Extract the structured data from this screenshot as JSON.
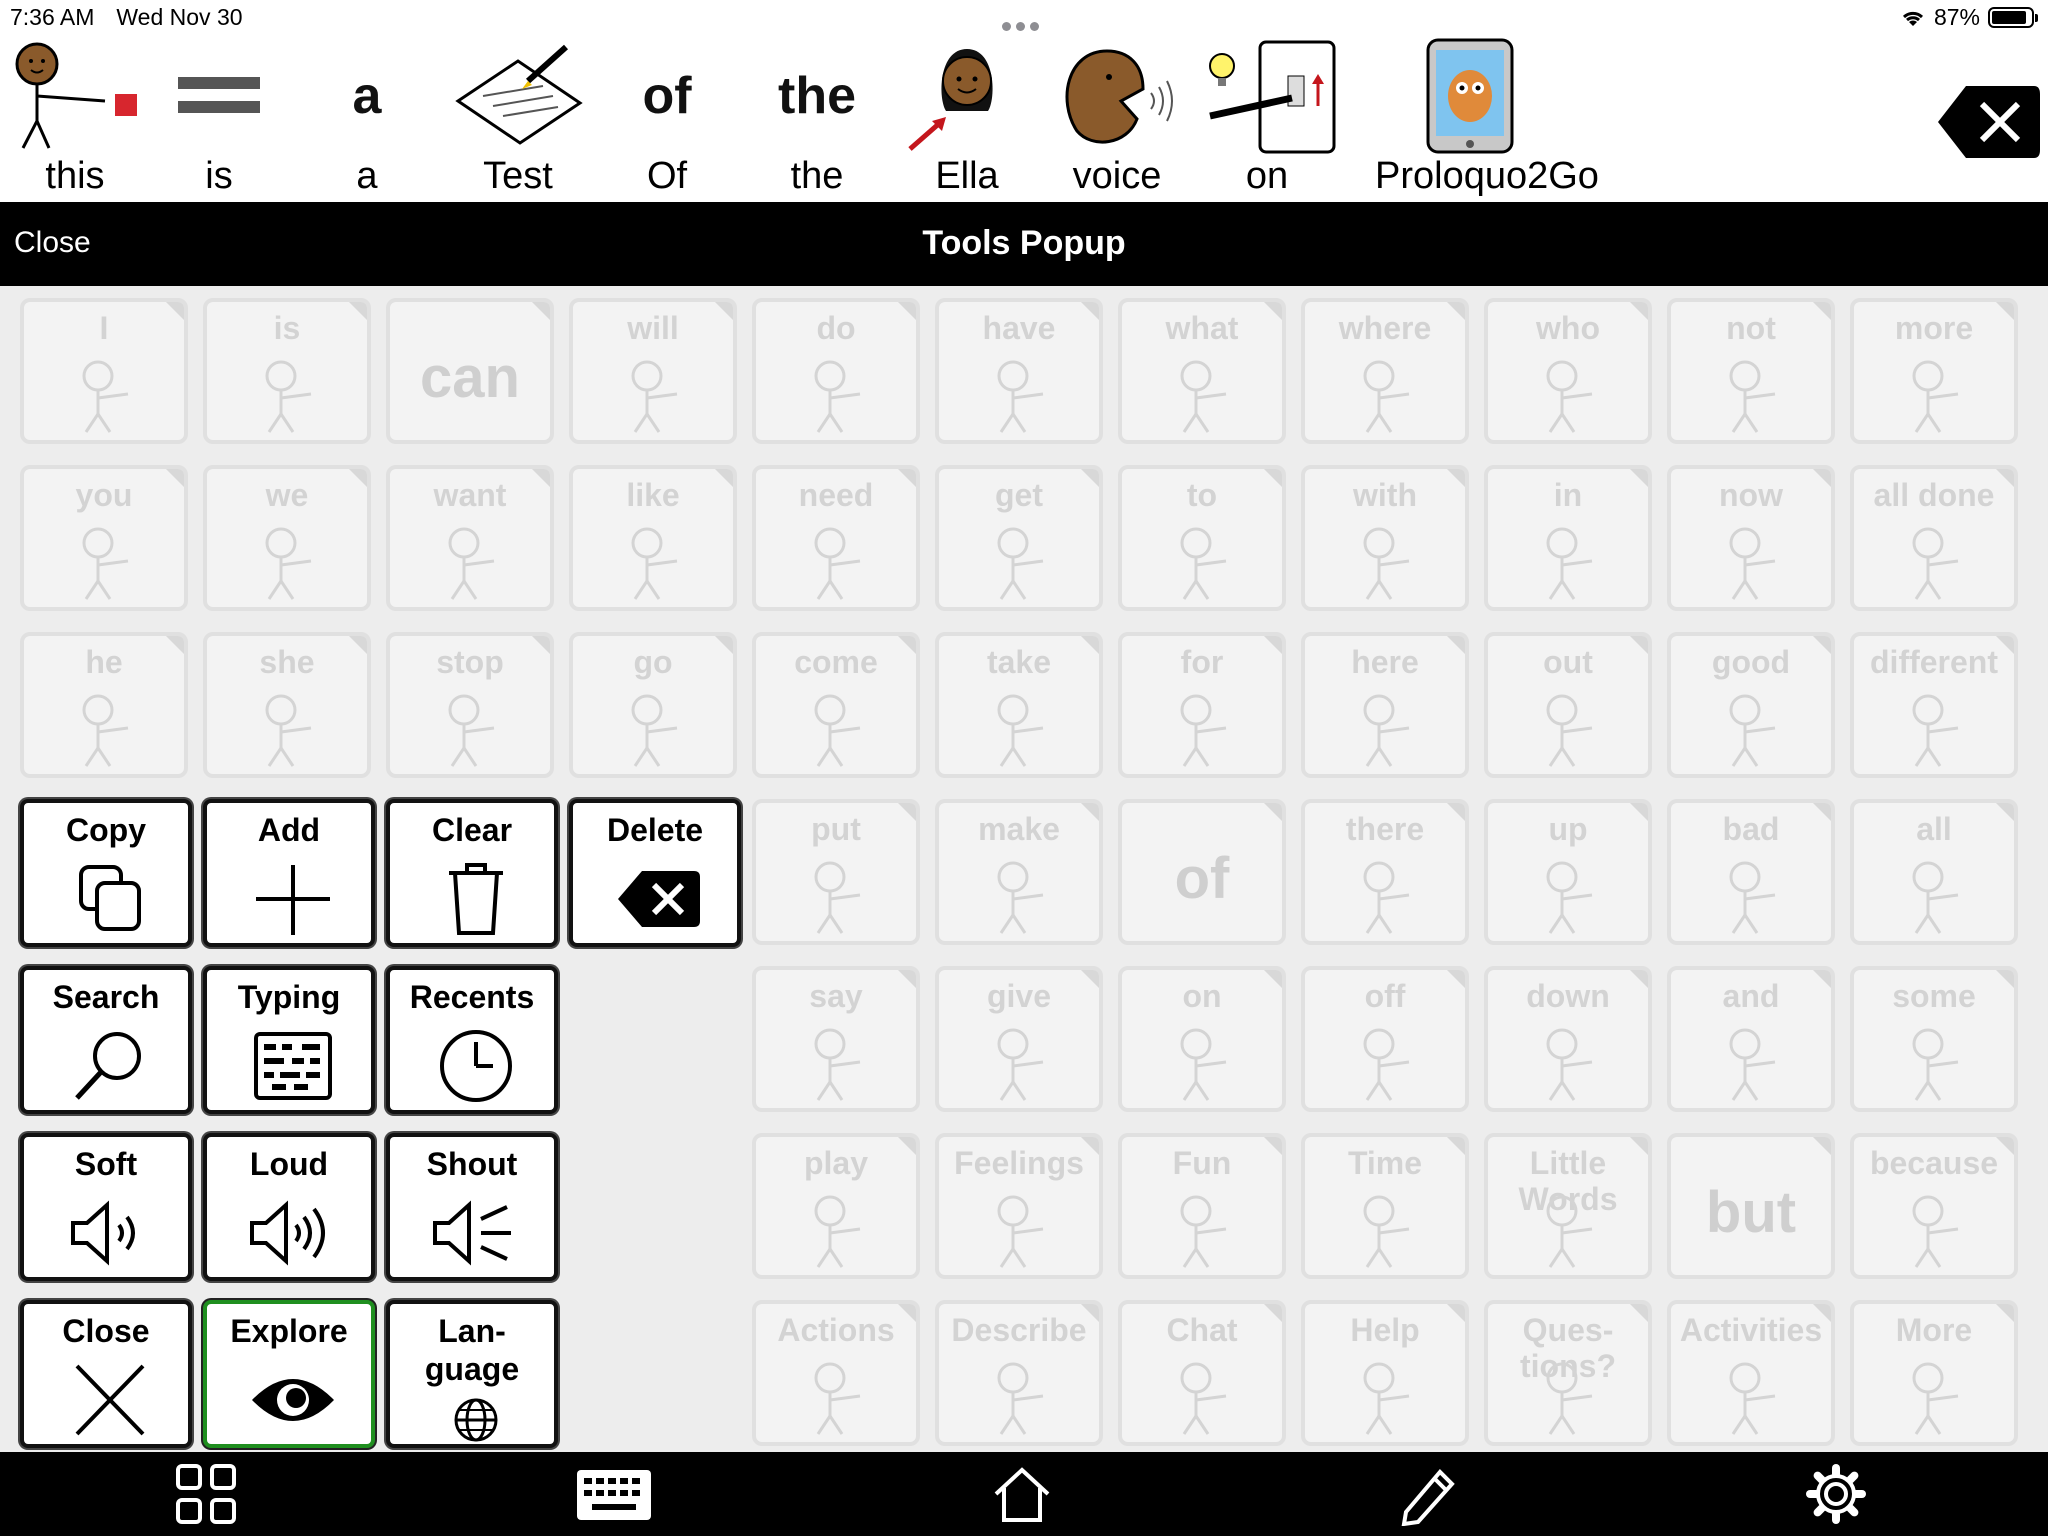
{
  "status": {
    "time": "7:36 AM",
    "date": "Wed Nov 30",
    "battery": "87%"
  },
  "message_bar": {
    "words": [
      {
        "label": "this",
        "symbol": "person-pointing-icon"
      },
      {
        "label": "is",
        "symbol": "equals-icon"
      },
      {
        "label": "a",
        "symbol_text": "a"
      },
      {
        "label": "Test",
        "symbol": "test-paper-icon"
      },
      {
        "label": "Of",
        "symbol_text": "of"
      },
      {
        "label": "the",
        "symbol_text": "the"
      },
      {
        "label": "Ella",
        "symbol": "girl-icon"
      },
      {
        "label": "voice",
        "symbol": "voice-icon"
      },
      {
        "label": "on",
        "symbol": "light-switch-icon"
      },
      {
        "label": "Proloquo2Go",
        "symbol": "tablet-owl-icon"
      }
    ]
  },
  "popup": {
    "close_label": "Close",
    "title": "Tools Popup"
  },
  "vocab_grid": {
    "rows": [
      [
        "I",
        "is",
        "can",
        "will",
        "do",
        "have",
        "what",
        "where",
        "who",
        "not",
        "more"
      ],
      [
        "you",
        "we",
        "want",
        "like",
        "need",
        "get",
        "to",
        "with",
        "in",
        "now",
        "all done"
      ],
      [
        "he",
        "she",
        "stop",
        "go",
        "come",
        "take",
        "for",
        "here",
        "out",
        "good",
        "different"
      ],
      [
        "",
        "",
        "",
        "",
        "put",
        "make",
        "of",
        "there",
        "up",
        "bad",
        "all"
      ],
      [
        "",
        "",
        "",
        "",
        "say",
        "give",
        "on",
        "off",
        "down",
        "and",
        "some"
      ],
      [
        "",
        "",
        "",
        "",
        "play",
        "Feelings",
        "Fun",
        "Time",
        "Little Words",
        "but",
        "because"
      ],
      [
        "",
        "",
        "",
        "",
        "Actions",
        "Describe",
        "Chat",
        "Help",
        "Ques-tions?",
        "Activities",
        "More"
      ]
    ]
  },
  "tools": [
    {
      "label": "Copy",
      "icon": "copy-icon"
    },
    {
      "label": "Add",
      "icon": "plus-icon"
    },
    {
      "label": "Clear",
      "icon": "trash-icon"
    },
    {
      "label": "Delete",
      "icon": "delete-icon"
    },
    {
      "label": "Search",
      "icon": "search-icon"
    },
    {
      "label": "Typing",
      "icon": "keyboard-icon"
    },
    {
      "label": "Recents",
      "icon": "clock-icon"
    },
    {
      "label": "Soft",
      "icon": "speaker-soft-icon"
    },
    {
      "label": "Loud",
      "icon": "speaker-loud-icon"
    },
    {
      "label": "Shout",
      "icon": "speaker-shout-icon"
    },
    {
      "label": "Close",
      "icon": "close-icon"
    },
    {
      "label": "Explore",
      "icon": "eye-icon"
    },
    {
      "label": "Lan-\nguage",
      "icon": "globe-icon"
    }
  ],
  "bottom_toolbar": [
    "grid-icon",
    "keyboard-icon",
    "home-icon",
    "pencil-icon",
    "gear-icon"
  ],
  "colors": {
    "header": "#000000",
    "explore_border": "#1f8f1f",
    "arrow": "#f0364a"
  }
}
